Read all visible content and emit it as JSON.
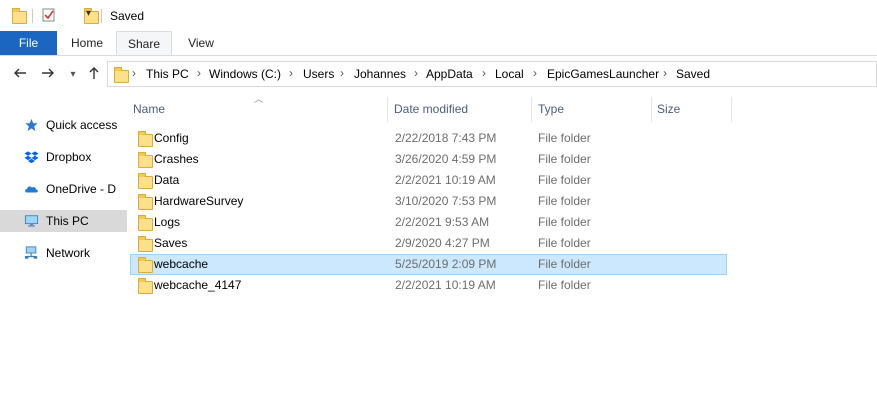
{
  "window": {
    "title": "Saved"
  },
  "ribbon": {
    "tabs": [
      "File",
      "Home",
      "Share",
      "View"
    ],
    "active_tab": "Share"
  },
  "address": {
    "breadcrumb": [
      "This PC",
      "Windows (C:)",
      "Users",
      "Johannes",
      "AppData",
      "Local",
      "EpicGamesLauncher",
      "Saved"
    ]
  },
  "sidebar": {
    "items": [
      {
        "label": "Quick access",
        "icon": "star-icon"
      },
      {
        "label": "Dropbox",
        "icon": "dropbox-icon"
      },
      {
        "label": "OneDrive - D",
        "icon": "onedrive-icon"
      },
      {
        "label": "This PC",
        "icon": "computer-icon",
        "selected": true
      },
      {
        "label": "Network",
        "icon": "network-icon"
      }
    ]
  },
  "columns": {
    "name": "Name",
    "date": "Date modified",
    "type": "Type",
    "size": "Size",
    "sort": "name-ascending"
  },
  "files": [
    {
      "name": "Config",
      "date": "2/22/2018 7:43 PM",
      "type": "File folder"
    },
    {
      "name": "Crashes",
      "date": "3/26/2020 4:59 PM",
      "type": "File folder"
    },
    {
      "name": "Data",
      "date": "2/2/2021 10:19 AM",
      "type": "File folder"
    },
    {
      "name": "HardwareSurvey",
      "date": "3/10/2020 7:53 PM",
      "type": "File folder"
    },
    {
      "name": "Logs",
      "date": "2/2/2021 9:53 AM",
      "type": "File folder"
    },
    {
      "name": "Saves",
      "date": "2/9/2020 4:27 PM",
      "type": "File folder"
    },
    {
      "name": "webcache",
      "date": "5/25/2019 2:09 PM",
      "type": "File folder",
      "selected": true
    },
    {
      "name": "webcache_4147",
      "date": "2/2/2021 10:19 AM",
      "type": "File folder"
    }
  ],
  "colors": {
    "file_tab": "#1a66c0",
    "selection_bg": "#cce8ff",
    "selection_border": "#99d1ff",
    "folder": "#ffe08a"
  }
}
